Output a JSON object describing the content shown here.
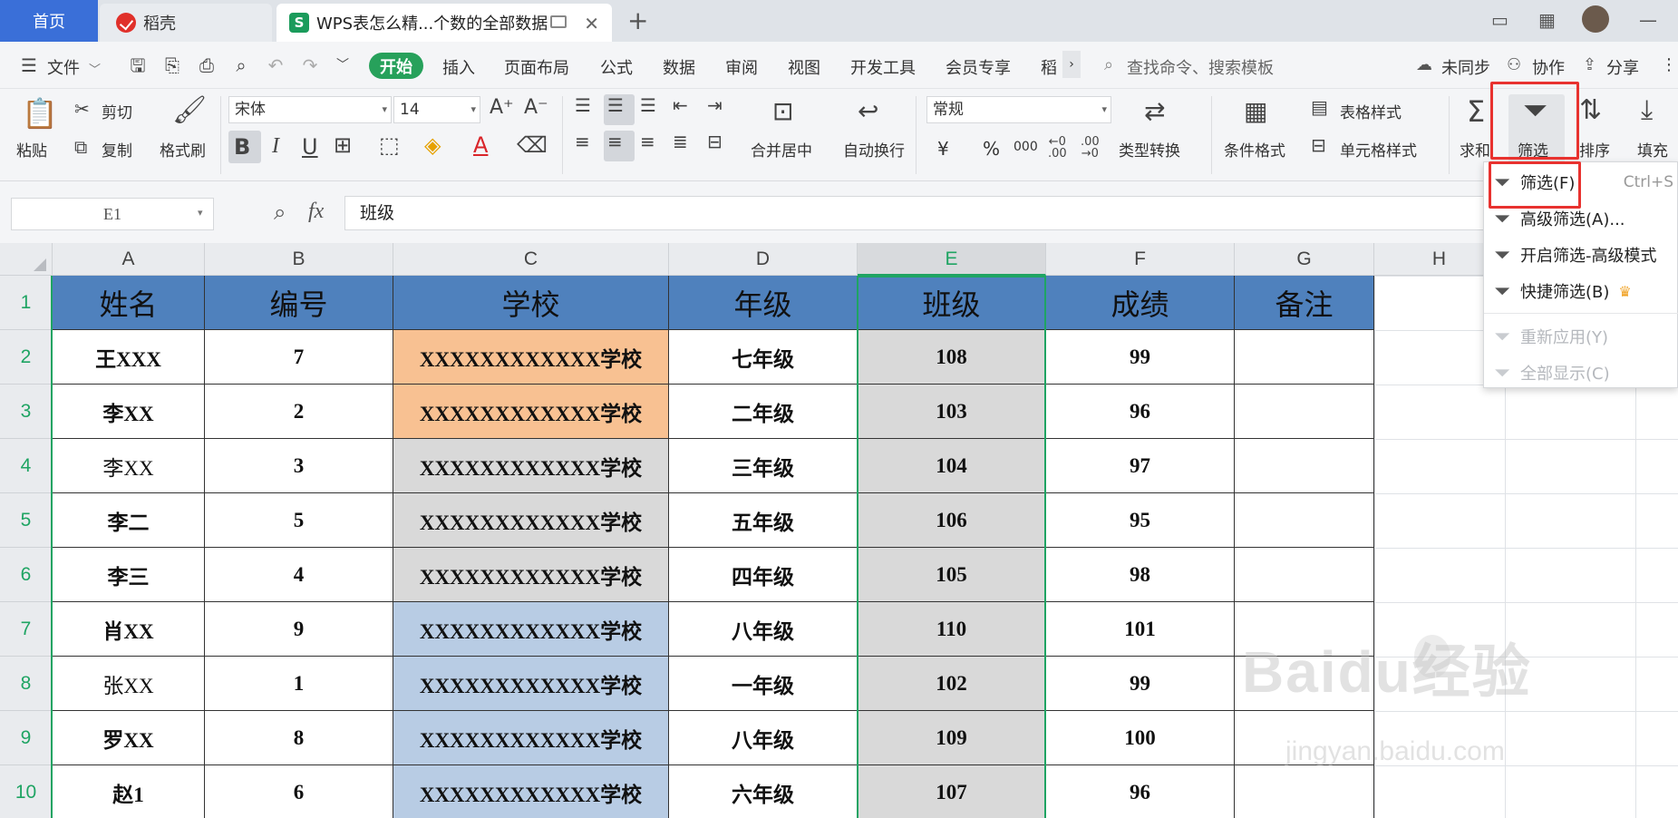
{
  "tabs": {
    "home": "首页",
    "daoke": "稻壳",
    "document": "WPS表怎么精...个数的全部数据",
    "close": "✕",
    "add": "+"
  },
  "menu": {
    "file": "文件",
    "items": [
      "开始",
      "插入",
      "页面布局",
      "公式",
      "数据",
      "审阅",
      "视图",
      "开发工具",
      "会员专享",
      "稻"
    ],
    "search_placeholder": "查找命令、搜索模板",
    "sync": "未同步",
    "collab": "协作",
    "share": "分享"
  },
  "ribbon": {
    "paste": "粘贴",
    "cut": "剪切",
    "copy": "复制",
    "format_painter": "格式刷",
    "font_name": "宋体",
    "font_size": "14",
    "merge_center": "合并居中",
    "wrap_text": "自动换行",
    "number_format": "常规",
    "currency": "¥",
    "percent": "%",
    "thousands": "000",
    "type_convert": "类型转换",
    "cond_format": "条件格式",
    "table_style": "表格样式",
    "cell_style": "单元格样式",
    "sum": "求和",
    "filter": "筛选",
    "sort": "排序",
    "fill": "填充"
  },
  "formula_bar": {
    "name_box": "E1",
    "fx": "fx",
    "value": "班级"
  },
  "columns": [
    "A",
    "B",
    "C",
    "D",
    "E",
    "F",
    "G",
    "H"
  ],
  "rows": [
    "1",
    "2",
    "3",
    "4",
    "5",
    "6",
    "7",
    "8",
    "9",
    "10"
  ],
  "table": {
    "headers": [
      "姓名",
      "编号",
      "学校",
      "年级",
      "班级",
      "成绩",
      "备注"
    ],
    "data": [
      [
        "王XXX",
        "7",
        "XXXXXXXXXXXX学校",
        "七年级",
        "108",
        "99",
        ""
      ],
      [
        "李XX",
        "2",
        "XXXXXXXXXXXX学校",
        "二年级",
        "103",
        "96",
        ""
      ],
      [
        "李XX",
        "3",
        "XXXXXXXXXXXX学校",
        "三年级",
        "104",
        "97",
        ""
      ],
      [
        "李二",
        "5",
        "XXXXXXXXXXXX学校",
        "五年级",
        "106",
        "95",
        ""
      ],
      [
        "李三",
        "4",
        "XXXXXXXXXXXX学校",
        "四年级",
        "105",
        "98",
        ""
      ],
      [
        "肖XX",
        "9",
        "XXXXXXXXXXXX学校",
        "八年级",
        "110",
        "101",
        ""
      ],
      [
        "张XX",
        "1",
        "XXXXXXXXXXXX学校",
        "一年级",
        "102",
        "99",
        ""
      ],
      [
        "罗XX",
        "8",
        "XXXXXXXXXXXX学校",
        "八年级",
        "109",
        "100",
        ""
      ],
      [
        "赵1",
        "6",
        "XXXXXXXXXXXX学校",
        "六年级",
        "107",
        "96",
        ""
      ]
    ],
    "school_fill": [
      "#f8c192",
      "#f8c192",
      "#d9d9d9",
      "#d9d9d9",
      "#d9d9d9",
      "#b8cce4",
      "#b8cce4",
      "#b8cce4",
      "#b8cce4"
    ],
    "name_bold": [
      true,
      true,
      false,
      true,
      true,
      true,
      false,
      true,
      true
    ],
    "header_fill": "#4f81bd",
    "selected_col_fill": "#d9d9d9"
  },
  "filter_menu": {
    "items": [
      {
        "label": "筛选(F)",
        "shortcut": "Ctrl+Shift+L",
        "enabled": true
      },
      {
        "label": "高级筛选(A)...",
        "enabled": true
      },
      {
        "label": "开启筛选-高级模式",
        "enabled": true
      },
      {
        "label": "快捷筛选(B)",
        "enabled": true
      },
      {
        "label": "重新应用(Y)",
        "enabled": false
      },
      {
        "label": "全部显示(C)",
        "enabled": false
      }
    ]
  },
  "watermark": {
    "brand": "Baidu经验",
    "url": "jingyan.baidu.com"
  },
  "colors": {
    "accent_green": "#27a15b",
    "home_tab": "#3a6fd8",
    "highlight_red": "#e8322f"
  }
}
